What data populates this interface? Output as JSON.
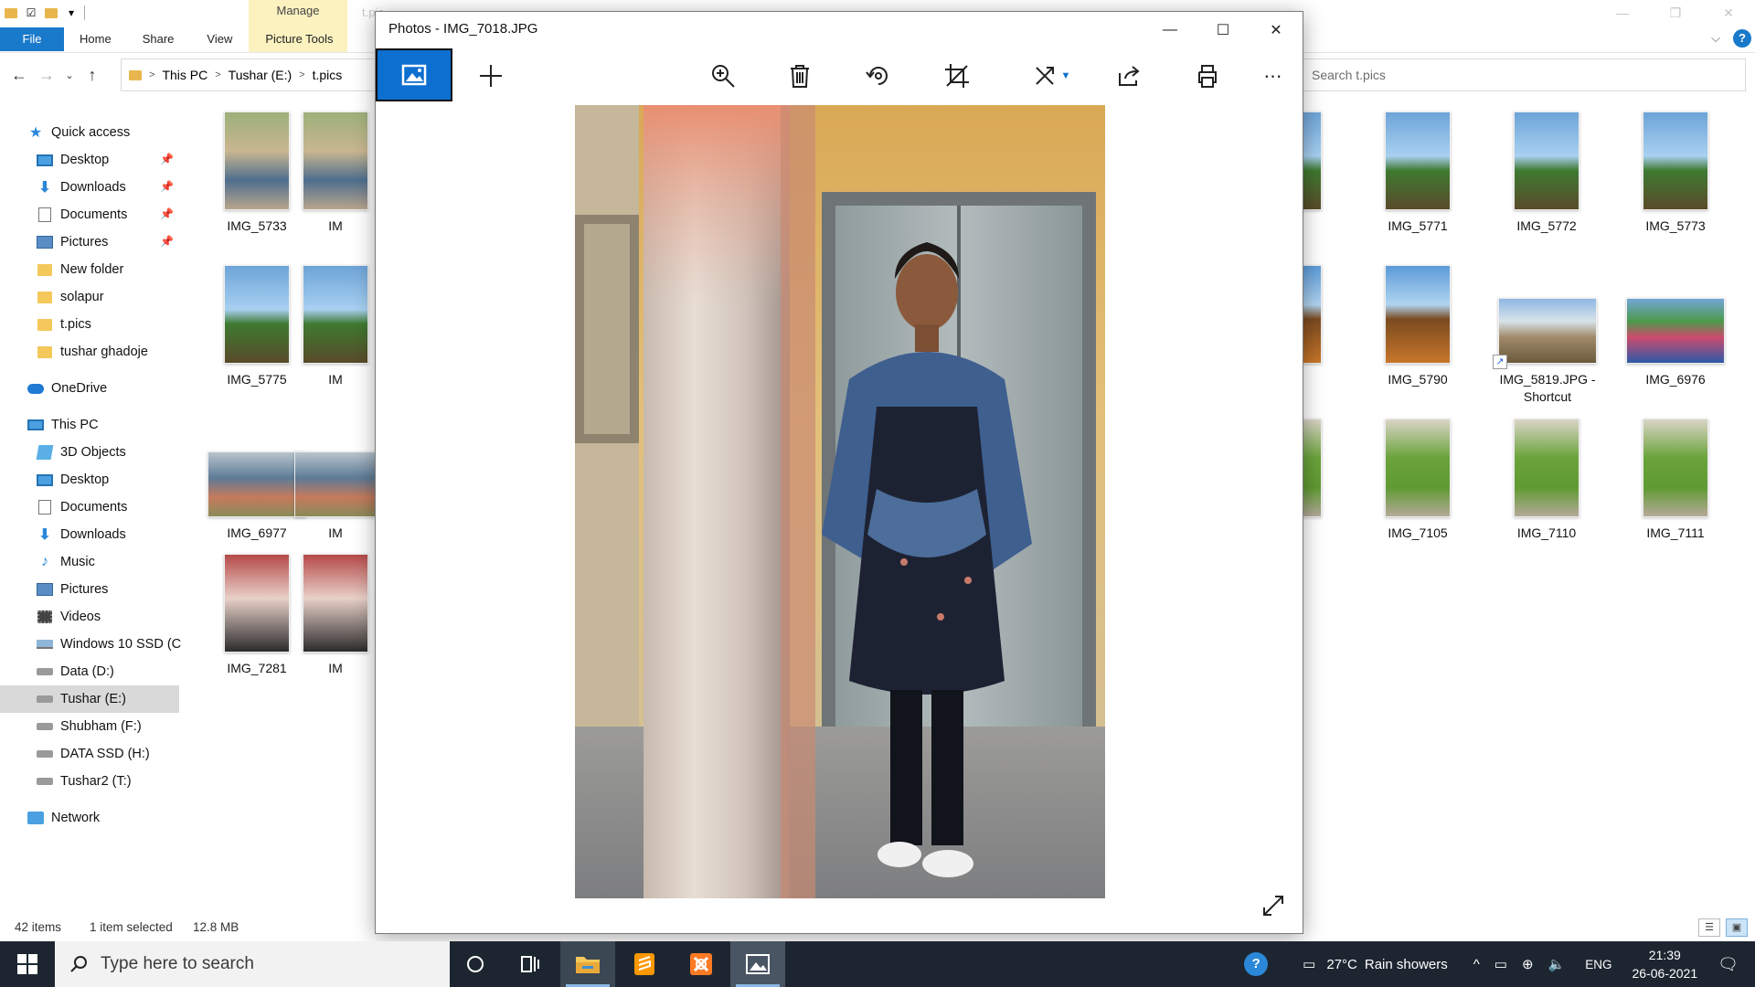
{
  "explorer": {
    "ghost_title": "t.pic",
    "ribbon": {
      "context_group": "Manage",
      "tabs": [
        "File",
        "Home",
        "Share",
        "View",
        "Picture Tools"
      ]
    },
    "breadcrumb": [
      "This PC",
      "Tushar (E:)",
      "t.pics"
    ],
    "search_placeholder": "Search t.pics",
    "nav": {
      "quick_access": "Quick access",
      "quick_items": [
        "Desktop",
        "Downloads",
        "Documents",
        "Pictures",
        "New folder",
        "solapur",
        "t.pics",
        "tushar ghadoje"
      ],
      "onedrive": "OneDrive",
      "this_pc": "This PC",
      "pc_items": [
        "3D Objects",
        "Desktop",
        "Documents",
        "Downloads",
        "Music",
        "Pictures",
        "Videos",
        "Windows 10 SSD (C",
        "Data (D:)",
        "Tushar (E:)",
        "Shubham (F:)",
        "DATA SSD (H:)",
        "Tushar2 (T:)"
      ],
      "network": "Network"
    },
    "files": {
      "f1": "IMG_5733",
      "f2": "IM",
      "f3": "IMG_5775",
      "f4": "IM",
      "f5": "IMG_6977",
      "f6": "IM",
      "f7": "IMG_7281",
      "f8": "IM",
      "r1": "770",
      "r2": "IMG_5771",
      "r3": "IMG_5772",
      "r4": "IMG_5773",
      "r5": "789",
      "r6": "IMG_5790",
      "r7": "IMG_5819.JPG - Shortcut",
      "r8": "IMG_6976",
      "r9": "104",
      "r10": "IMG_7105",
      "r11": "IMG_7110",
      "r12": "IMG_7111"
    },
    "status": {
      "count": "42 items",
      "selection": "1 item selected",
      "size": "12.8 MB"
    }
  },
  "photos": {
    "title": "Photos - IMG_7018.JPG"
  },
  "taskbar": {
    "search_placeholder": "Type here to search",
    "weather_temp": "27°C",
    "weather_text": "Rain showers",
    "lang": "ENG",
    "time": "21:39",
    "date": "26-06-2021"
  }
}
